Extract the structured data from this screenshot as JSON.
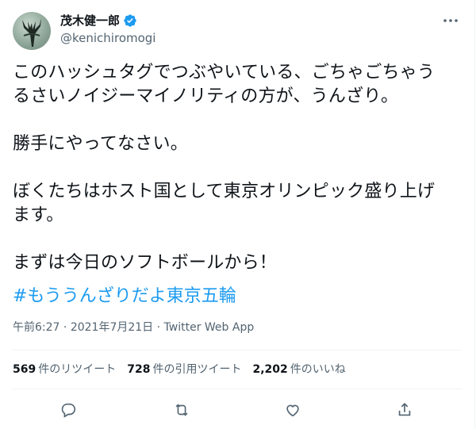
{
  "author": {
    "display_name": "茂木健一郎",
    "handle": "@kenichiromogi",
    "verified": true,
    "avatar_icon": "avatar-image"
  },
  "tweet": {
    "paragraphs": [
      "このハッシュタグでつぶやいている、ごちゃごちゃう\nるさいノイジーマイノリティの方が、うんざり。",
      "勝手にやってなさい。",
      "ぼくたちはホスト国として東京オリンピック盛り上げ\nます。",
      "まずは今日のソフトボールから！"
    ],
    "hashtag": "#もううんざりだよ東京五輪",
    "time": "午前6:27",
    "date": "2021年7月21日",
    "separator": "·",
    "source": "Twitter Web App"
  },
  "stats": {
    "retweets": {
      "count": "569",
      "label": "件のリツイート"
    },
    "quotes": {
      "count": "728",
      "label": "件の引用ツイート"
    },
    "likes": {
      "count": "2,202",
      "label": "件のいいね"
    }
  },
  "actions": [
    "reply-icon",
    "retweet-icon",
    "like-icon",
    "share-icon"
  ],
  "colors": {
    "link": "#1d9bf0",
    "secondary_text": "#536471",
    "divider": "#eff3f4"
  }
}
